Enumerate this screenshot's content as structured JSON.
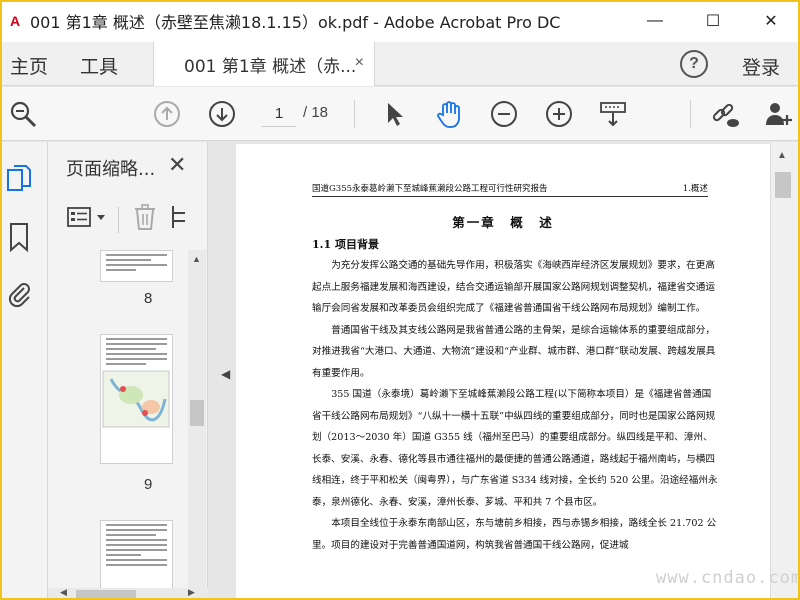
{
  "window": {
    "title": "001 第1章 概述（赤壁至焦濑18.1.15）ok.pdf - Adobe Acrobat Pro DC",
    "app_icon_label": "A",
    "minimize_icon": "—",
    "maximize_icon": "☐",
    "close_icon": "✕"
  },
  "tabs": {
    "home": "主页",
    "tools": "工具",
    "document": "001 第1章 概述（赤...",
    "close_glyph": "×",
    "help_glyph": "?",
    "sign_in": "登录"
  },
  "toolbar": {
    "current_page": "1",
    "total_pages": "/ 18",
    "icons": [
      "search-icon",
      "page-up-icon",
      "page-down-icon",
      "select-arrow-icon",
      "hand-icon",
      "zoom-out-icon",
      "zoom-in-icon",
      "marquee-zoom-icon",
      "share-link-icon",
      "add-user-icon"
    ]
  },
  "rail": {
    "icons": [
      "page-thumbnails-icon",
      "bookmarks-icon",
      "attachments-icon"
    ]
  },
  "thumbnails": {
    "title": "页面缩略...",
    "close_glyph": "✕",
    "pages": [
      {
        "label": "8"
      },
      {
        "label": "9"
      }
    ]
  },
  "document": {
    "running_head_left": "国道G355永泰葛岭濑下至城峰蕉濑段公路工程可行性研究报告",
    "running_head_right": "1.概述",
    "chapter_title": "第一章　概　述",
    "section_title": "1.1 项目背景",
    "paragraphs": [
      "为充分发挥公路交通的基础先导作用，积极落实《海峡西岸经济区发展规划》要求，在更高起点上服务福建发展和海西建设，结合交通运输部开展国家公路网规划调整契机，福建省交通运输厅会同省发展和改革委员会组织完成了《福建省普通国省干线公路网布局规划》编制工作。",
      "普通国省干线及其支线公路网是我省普通公路的主骨架，是综合运输体系的重要组成部分，对推进我省“大港口、大通道、大物流”建设和“产业群、城市群、港口群”联动发展、跨越发展具有重要作用。",
      "355 国道（永泰境）葛岭濑下至城峰蕉濑段公路工程(以下简称本项目）是《福建省普通国省干线公路网布局规划》“八纵十一横十五联”中纵四线的重要组成部分，同时也是国家公路网规划（2013～2030 年）国道 G355 线（福州至巴马）的重要组成部分。纵四线是平和、漳州、长泰、安溪、永春、德化等县市通往福州的最便捷的普通公路通道，路线起于福州南屿，与横四线相连，终于平和松关（闽粤界），与广东省道 S334 线对接，全长约 520 公里。沿途经福州永泰，泉州德化、永春、安溪，漳州长泰、芗城、平和共 7 个县市区。",
      "本项目全线位于永泰东南部山区，东与塘前乡相接，西与赤锡乡相接，路线全长 21.702 公里。项目的建设对于完善普通国道网，构筑我省普通国干线公路网，促进城"
    ]
  },
  "watermark": "www.cndao.com"
}
